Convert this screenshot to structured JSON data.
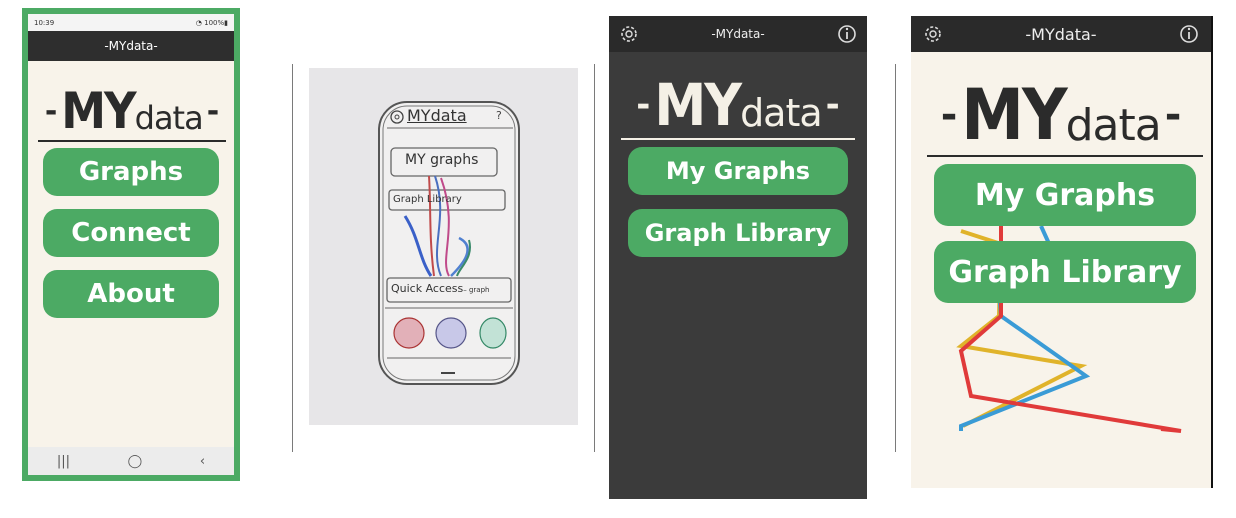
{
  "panel1": {
    "status": {
      "time": "10:39",
      "battery": "100%"
    },
    "appbar_title": "-MYdata-",
    "logo": {
      "dash": "-",
      "my": "MY",
      "data": "data"
    },
    "buttons": [
      "Graphs",
      "Connect",
      "About"
    ],
    "nav": {
      "recent": "|||",
      "home": "◯",
      "back": "‹"
    },
    "frame_color": "#4caa64"
  },
  "panel2": {
    "logo": "MYdata",
    "info": "?",
    "my_graphs": "MY graphs",
    "graph_library": "Graph Library",
    "quick_access": "Quick Access",
    "graph_suffix": "– graph"
  },
  "panel3": {
    "appbar_title": "-MYdata-",
    "logo": {
      "dash": "-",
      "my": "MY",
      "data": "data"
    },
    "buttons": [
      "My Graphs",
      "Graph Library"
    ],
    "icons": [
      "gear-icon",
      "info-icon"
    ]
  },
  "panel4": {
    "appbar_title": "-MYdata-",
    "logo": {
      "dash": "-",
      "my": "MY",
      "data": "data"
    },
    "buttons": [
      "My Graphs",
      "Graph Library"
    ],
    "icons": [
      "gear-icon",
      "info-icon"
    ],
    "line_colors": [
      "#e03a3a",
      "#3a9bd6",
      "#e0b32a"
    ]
  },
  "colors": {
    "accent": "#4caa64",
    "cream": "#f8f3ea",
    "dark": "#3b3b3b",
    "bar": "#2a2a2a"
  }
}
